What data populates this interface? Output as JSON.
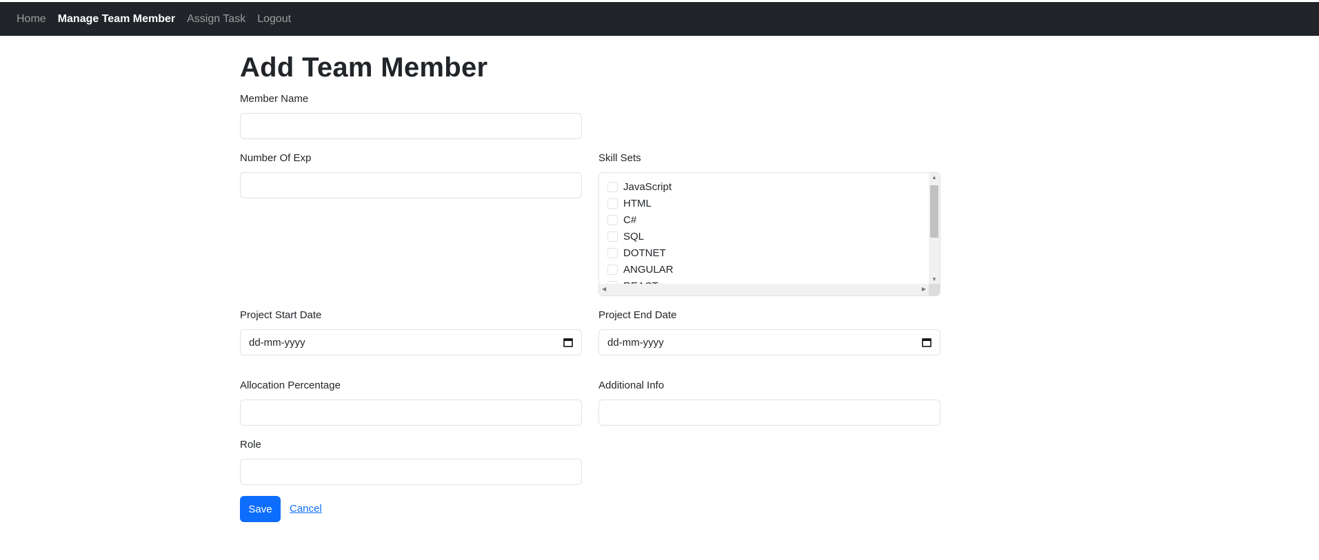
{
  "nav": {
    "items": [
      {
        "label": "Home",
        "active": false
      },
      {
        "label": "Manage Team Member",
        "active": true
      },
      {
        "label": "Assign Task",
        "active": false
      },
      {
        "label": "Logout",
        "active": false
      }
    ]
  },
  "page": {
    "title": "Add Team Member"
  },
  "form": {
    "member_name": {
      "label": "Member Name",
      "value": ""
    },
    "number_of_exp": {
      "label": "Number Of Exp",
      "value": ""
    },
    "skill_sets": {
      "label": "Skill Sets",
      "options": [
        "JavaScript",
        "HTML",
        "C#",
        "SQL",
        "DOTNET",
        "ANGULAR",
        "REACT"
      ]
    },
    "project_start_date": {
      "label": "Project Start Date",
      "placeholder": "dd-mm-yyyy"
    },
    "project_end_date": {
      "label": "Project End Date",
      "placeholder": "dd-mm-yyyy"
    },
    "allocation_percentage": {
      "label": "Allocation Percentage",
      "value": ""
    },
    "additional_info": {
      "label": "Additional Info",
      "value": ""
    },
    "role": {
      "label": "Role",
      "value": ""
    }
  },
  "actions": {
    "save_label": "Save",
    "cancel_label": "Cancel"
  },
  "colors": {
    "navbar": "#212529",
    "primary": "#0d6efd",
    "border": "#dee2e6"
  },
  "icons": {
    "date_picker": "calendar-icon"
  }
}
